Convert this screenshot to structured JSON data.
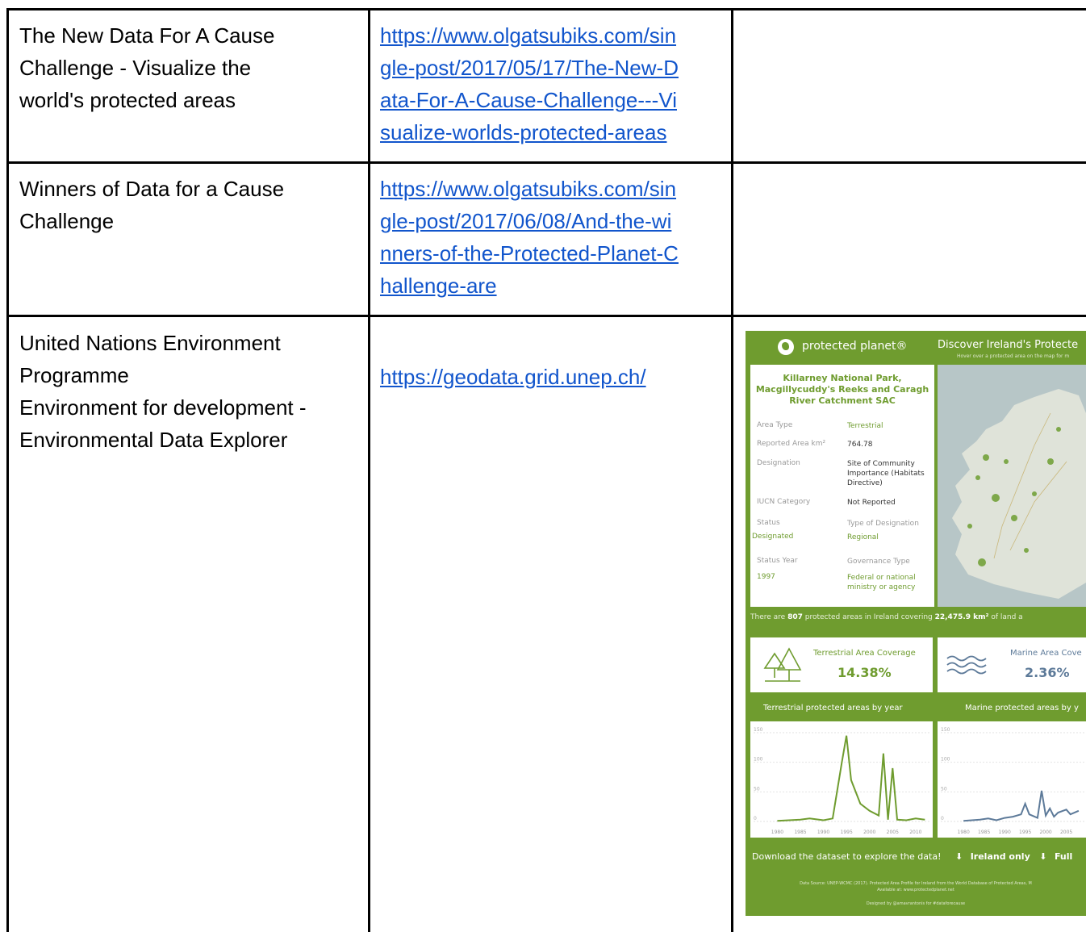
{
  "rows": [
    {
      "title_lines": [
        "The New Data For A Cause",
        "Challenge - Visualize the",
        "world's protected areas"
      ],
      "url": "https://www.olgatsubiks.com/single-post/2017/05/17/The-New-Data-For-A-Cause-Challenge---Visualize-worlds-protected-areas",
      "url_lines": [
        "https://www.olgatsubiks.com/sin",
        "gle-post/2017/05/17/The-New-D",
        "ata-For-A-Cause-Challenge---Vi",
        "sualize-worlds-protected-areas"
      ]
    },
    {
      "title_lines": [
        "Winners of Data for a Cause",
        "Challenge"
      ],
      "url": "https://www.olgatsubiks.com/single-post/2017/06/08/And-the-winners-of-the-Protected-Planet-Challenge-are",
      "url_lines": [
        "https://www.olgatsubiks.com/sin",
        "gle-post/2017/06/08/And-the-wi",
        "nners-of-the-Protected-Planet-C",
        "hallenge-are"
      ]
    },
    {
      "title_lines": [
        "United Nations Environment",
        "Programme",
        "Environment for development -",
        "Environmental Data Explorer"
      ],
      "url": "https://geodata.grid.unep.ch/",
      "url_lines": [
        "https://geodata.grid.unep.ch/"
      ]
    }
  ],
  "dashboard": {
    "brand": "protected planet®",
    "title": "Discover Ireland's Protecte",
    "subtitle": "Hover over a protected area on the map for m",
    "site_name": "Killarney National Park, Macgillycuddy's Reeks and Caragh River Catchment SAC",
    "fields": {
      "area_type_label": "Area Type",
      "area_type": "Terrestrial",
      "reported_area_label": "Reported Area km²",
      "reported_area": "764.78",
      "designation_label": "Designation",
      "designation": "Site of Community Importance (Habitats Directive)",
      "iucn_label": "IUCN Category",
      "iucn": "Not Reported",
      "status_label": "Status",
      "status": "Designated",
      "type_label": "Type of Designation",
      "type": "Regional",
      "status_year_label": "Status Year",
      "status_year": "1997",
      "governance_label": "Governance Type",
      "governance": "Federal or national ministry or agency"
    },
    "stat_prefix": "There are",
    "stat_count": "807",
    "stat_mid": "protected areas in Ireland covering",
    "stat_area": "22,475.9 km²",
    "stat_suffix": "of land a",
    "terrestrial_label": "Terrestrial Area Coverage",
    "terrestrial_pct": "14.38%",
    "marine_label": "Marine Area Cove",
    "marine_pct": "2.36%",
    "download_prefix": "Download the dataset to explore the data!",
    "download_ireland": "Ireland only",
    "download_full": "Full",
    "source_line1": "Data Source: UNEP-WCMC (2017). Protected Area Profile for Ireland from the World Database of Protected Areas, M",
    "source_line2": "Available at: www.protectedplanet.net",
    "designer": "Designed by @amavrantonis for #dataforecause",
    "colors": {
      "green": "#6f9c2f",
      "marine": "#5d7a99"
    }
  },
  "chart_data": [
    {
      "type": "line",
      "title": "Terrestrial protected areas by year",
      "x": [
        1980,
        1985,
        1987,
        1990,
        1992,
        1994,
        1995,
        1996,
        1998,
        2000,
        2002,
        2003,
        2004,
        2005,
        2006,
        2008,
        2010,
        2012
      ],
      "series": [
        {
          "values": [
            1,
            3,
            5,
            2,
            5,
            100,
            145,
            70,
            30,
            18,
            10,
            115,
            3,
            90,
            3,
            2,
            5,
            3
          ]
        }
      ],
      "xticks": [
        "1980",
        "1985",
        "1990",
        "1995",
        "2000",
        "2005",
        "2010"
      ],
      "yticks": [
        "0",
        "50",
        "100",
        "150"
      ],
      "ylim": [
        0,
        150
      ]
    },
    {
      "type": "line",
      "title": "Marine protected areas by y",
      "x": [
        1980,
        1984,
        1986,
        1988,
        1990,
        1992,
        1994,
        1995,
        1996,
        1998,
        1999,
        2000,
        2001,
        2002,
        2003,
        2005,
        2006,
        2008
      ],
      "series": [
        {
          "values": [
            1,
            3,
            5,
            2,
            6,
            8,
            12,
            30,
            12,
            6,
            52,
            10,
            22,
            8,
            15,
            20,
            12,
            18
          ]
        }
      ],
      "xticks": [
        "1980",
        "1985",
        "1990",
        "1995",
        "2000",
        "2005"
      ],
      "yticks": [
        "0",
        "50",
        "100",
        "150"
      ],
      "ylim": [
        0,
        150
      ]
    }
  ]
}
